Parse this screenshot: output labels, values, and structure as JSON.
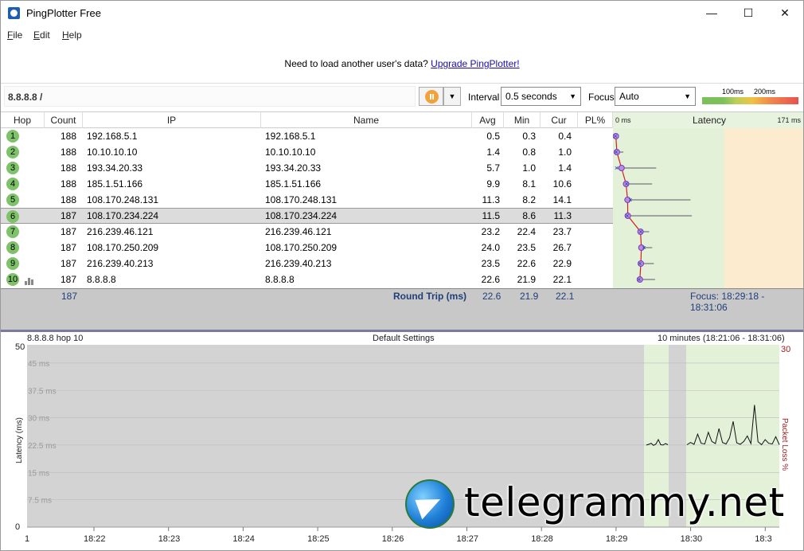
{
  "window": {
    "title": "PingPlotter Free",
    "minimize": "—",
    "maximize": "☐",
    "close": "✕"
  },
  "menu": [
    {
      "label": "File"
    },
    {
      "label": "Edit"
    },
    {
      "label": "Help"
    }
  ],
  "banner": {
    "text": "Need to load another user's data?",
    "link": "Upgrade PingPlotter!"
  },
  "toolbar": {
    "target": "8.8.8.8 /",
    "interval_label": "Interval",
    "interval_value": "0.5 seconds",
    "focus_label": "Focus",
    "focus_value": "Auto",
    "scale_100": "100ms",
    "scale_200": "200ms"
  },
  "table": {
    "headers": {
      "hop": "Hop",
      "count": "Count",
      "ip": "IP",
      "name": "Name",
      "avg": "Avg",
      "min": "Min",
      "cur": "Cur",
      "pl": "PL%",
      "lat_min": "0 ms",
      "latency": "Latency",
      "lat_max": "171 ms"
    },
    "rows": [
      {
        "hop": "1",
        "count": "188",
        "ip": "192.168.5.1",
        "name": "192.168.5.1",
        "avg": "0.5",
        "min": "0.3",
        "cur": "0.4",
        "pl": ""
      },
      {
        "hop": "2",
        "count": "188",
        "ip": "10.10.10.10",
        "name": "10.10.10.10",
        "avg": "1.4",
        "min": "0.8",
        "cur": "1.0",
        "pl": ""
      },
      {
        "hop": "3",
        "count": "188",
        "ip": "193.34.20.33",
        "name": "193.34.20.33",
        "avg": "5.7",
        "min": "1.0",
        "cur": "1.4",
        "pl": ""
      },
      {
        "hop": "4",
        "count": "188",
        "ip": "185.1.51.166",
        "name": "185.1.51.166",
        "avg": "9.9",
        "min": "8.1",
        "cur": "10.6",
        "pl": ""
      },
      {
        "hop": "5",
        "count": "188",
        "ip": "108.170.248.131",
        "name": "108.170.248.131",
        "avg": "11.3",
        "min": "8.2",
        "cur": "14.1",
        "pl": ""
      },
      {
        "hop": "6",
        "count": "187",
        "ip": "108.170.234.224",
        "name": "108.170.234.224",
        "avg": "11.5",
        "min": "8.6",
        "cur": "11.3",
        "pl": ""
      },
      {
        "hop": "7",
        "count": "187",
        "ip": "216.239.46.121",
        "name": "216.239.46.121",
        "avg": "23.2",
        "min": "22.4",
        "cur": "23.7",
        "pl": ""
      },
      {
        "hop": "8",
        "count": "187",
        "ip": "108.170.250.209",
        "name": "108.170.250.209",
        "avg": "24.0",
        "min": "23.5",
        "cur": "26.7",
        "pl": ""
      },
      {
        "hop": "9",
        "count": "187",
        "ip": "216.239.40.213",
        "name": "216.239.40.213",
        "avg": "23.5",
        "min": "22.6",
        "cur": "22.9",
        "pl": ""
      },
      {
        "hop": "10",
        "count": "187",
        "ip": "8.8.8.8",
        "name": "8.8.8.8",
        "avg": "22.6",
        "min": "21.9",
        "cur": "22.1",
        "pl": ""
      }
    ],
    "selected_hop": "6",
    "summary": {
      "count": "187",
      "label": "Round Trip (ms)",
      "avg": "22.6",
      "min": "21.9",
      "cur": "22.1",
      "focus": "Focus: 18:29:18 - 18:31:06"
    }
  },
  "graph": {
    "target_label": "8.8.8.8 hop 10",
    "settings_label": "Default Settings",
    "range_label": "10 minutes (18:21:06 - 18:31:06)",
    "ylabel": "Latency (ms)",
    "y2label": "Packet Loss %",
    "y_top": "50",
    "y_bottom": "0",
    "y2_top": "30",
    "y_gridlabels": [
      "45 ms",
      "37.5 ms",
      "30 ms",
      "22.5 ms",
      "15 ms",
      "7.5 ms"
    ],
    "x_start": "1",
    "x_ticks": [
      "18:22",
      "18:23",
      "18:24",
      "18:25",
      "18:26",
      "18:27",
      "18:28",
      "18:29",
      "18:30",
      "18:3"
    ]
  },
  "watermark": "telegrammy.net",
  "chart_data": {
    "type": "line",
    "title": "Default Settings",
    "ylabel": "Latency (ms)",
    "ylim": [
      0,
      50
    ],
    "x_ticks": [
      "18:22",
      "18:23",
      "18:24",
      "18:25",
      "18:26",
      "18:27",
      "18:28",
      "18:29",
      "18:30",
      "18:3"
    ],
    "series": [
      {
        "values_segment1": [
          22.5,
          22.7,
          23.0,
          22.4,
          22.8,
          24.0,
          22.6,
          22.5,
          22.9,
          22.6
        ],
        "values_segment2": [
          22.6,
          23.2,
          22.7,
          25.5,
          23.0,
          22.8,
          26.0,
          23.5,
          22.9,
          27.0,
          23.2,
          22.8,
          24.5,
          29.0,
          23.1,
          22.7,
          23.5,
          25.0,
          22.9,
          33.5,
          23.4,
          22.6,
          24.0,
          23.0,
          22.8,
          24.8,
          22.6
        ]
      }
    ]
  }
}
